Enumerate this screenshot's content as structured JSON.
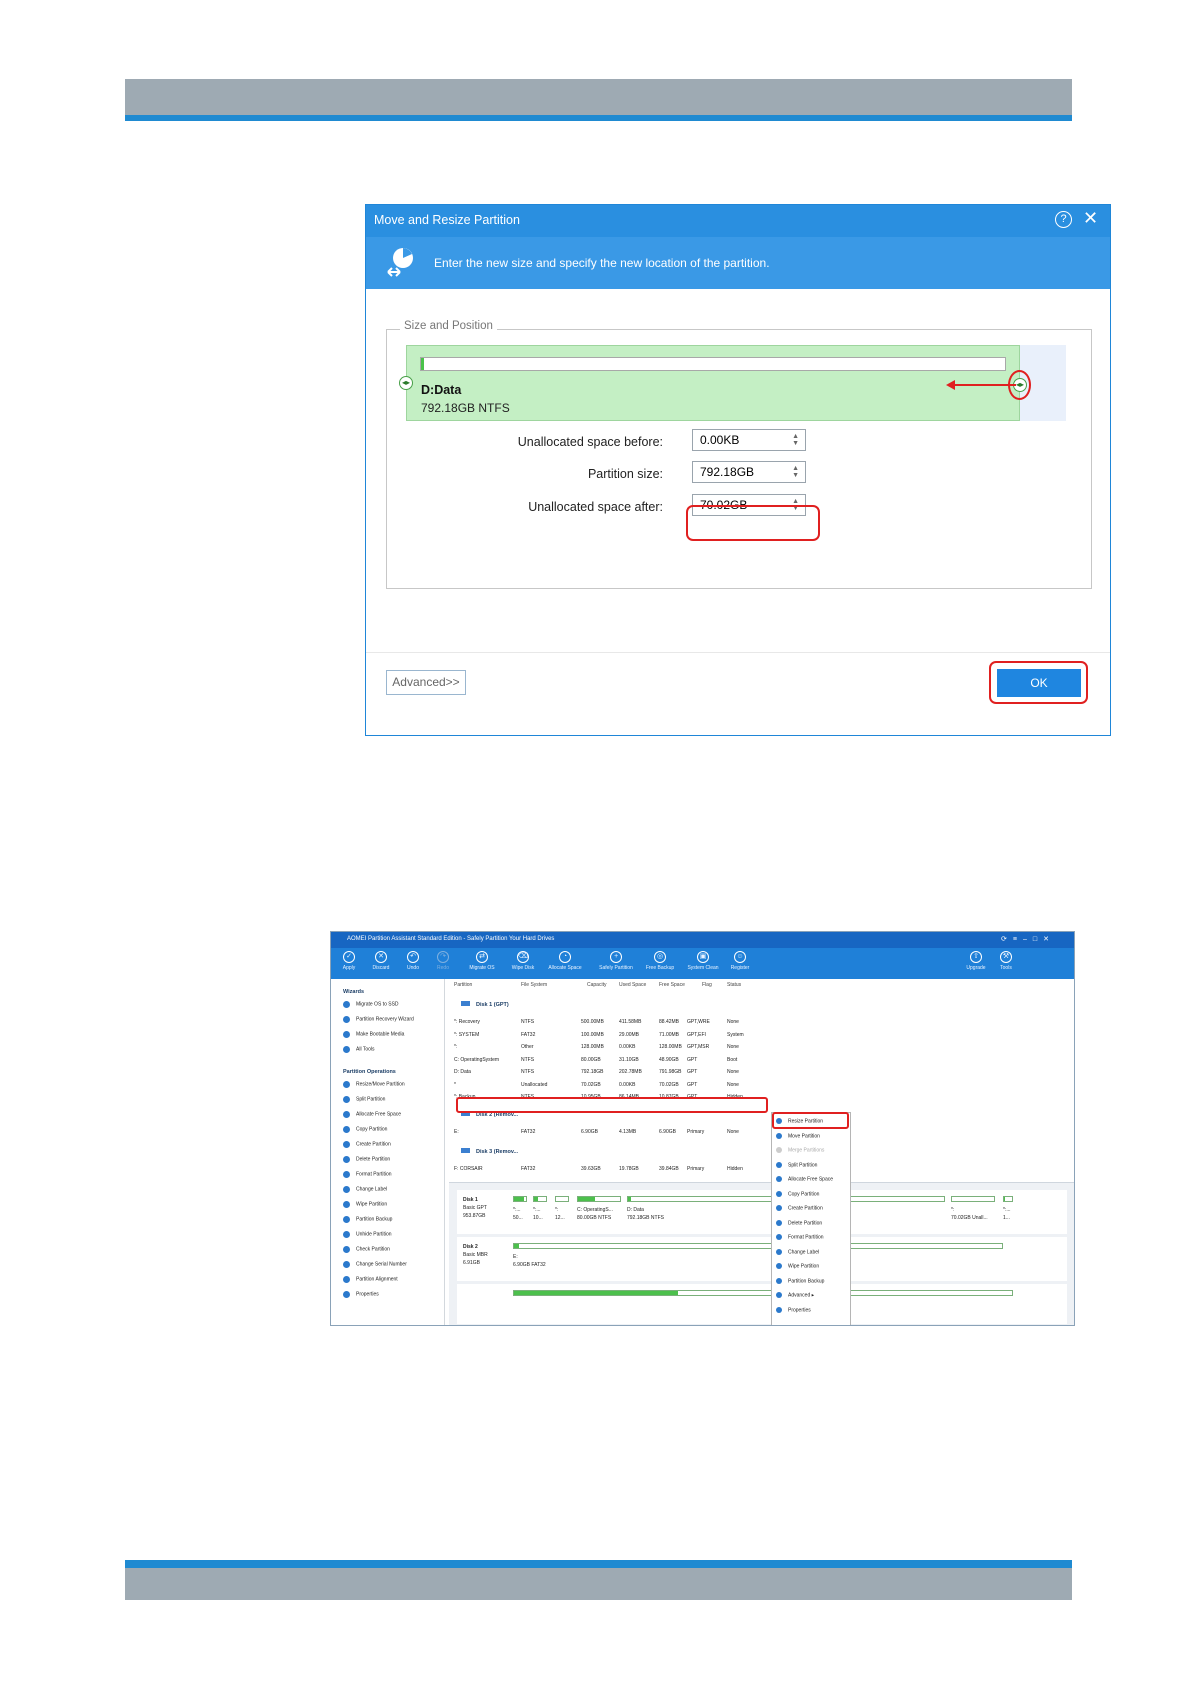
{
  "dialog": {
    "title": "Move and Resize Partition",
    "help_glyph": "?",
    "close_glyph": "✕",
    "banner_text": "Enter the new size and specify the new location of the partition.",
    "group_label": "Size and Position",
    "partition_name": "D:Data",
    "partition_size": "792.18GB NTFS",
    "unalloc_before_label": "Unallocated space before:",
    "unalloc_before_value": "0.00KB",
    "partition_size_label": "Partition size:",
    "partition_size_value": "792.18GB",
    "unalloc_after_label": "Unallocated space after:",
    "unalloc_after_value": "70.02GB",
    "advanced_button": "Advanced>>",
    "ok_button": "OK"
  },
  "aomei": {
    "title": "AOMEI Partition Assistant Standard Edition - Safely Partition Your Hard Drives",
    "toolbar": [
      "Apply",
      "Discard",
      "Undo",
      "Redo",
      "Migrate OS",
      "Wipe Disk",
      "Allocate Space",
      "Safely Partition",
      "Free Backup",
      "System Clean",
      "Register",
      "Upgrade",
      "Tools"
    ],
    "wizards_header": "Wizards",
    "wizards": [
      "Migrate OS to SSD",
      "Partition Recovery Wizard",
      "Make Bootable Media",
      "All Tools"
    ],
    "ops_header": "Partition Operations",
    "operations": [
      "Resize/Move Partition",
      "Split Partition",
      "Allocate Free Space",
      "Copy Partition",
      "Create Partition",
      "Delete Partition",
      "Format Partition",
      "Change Label",
      "Wipe Partition",
      "Partition Backup",
      "Unhide Partition",
      "Check Partition",
      "Change Serial Number",
      "Partition Alignment",
      "Properties"
    ],
    "columns": [
      "Partition",
      "File System",
      "Capacity",
      "Used Space",
      "Free Space",
      "Flag",
      "Status"
    ],
    "disk1_header": "Disk 1 (GPT)",
    "disk1_rows": [
      [
        "*: Recovery",
        "NTFS",
        "500.00MB",
        "411.58MB",
        "88.42MB",
        "GPT,WRE",
        "None"
      ],
      [
        "*: SYSTEM",
        "FAT32",
        "100.00MB",
        "29.00MB",
        "71.00MB",
        "GPT,EFI",
        "System"
      ],
      [
        "*:",
        "Other",
        "128.00MB",
        "0.00KB",
        "128.00MB",
        "GPT,MSR",
        "None"
      ],
      [
        "C: OperatingSystem",
        "NTFS",
        "80.00GB",
        "31.10GB",
        "48.90GB",
        "GPT",
        "Boot"
      ],
      [
        "D: Data",
        "NTFS",
        "792.18GB",
        "202.78MB",
        "791.98GB",
        "GPT",
        "None"
      ],
      [
        "*",
        "Unallocated",
        "70.02GB",
        "0.00KB",
        "70.02GB",
        "GPT",
        "None"
      ],
      [
        "*: Backup",
        "NTFS",
        "10.95GB",
        "86.14MB",
        "10.87GB",
        "GPT",
        "Hidden"
      ]
    ],
    "disk2_header": "Disk 2 (Remov...",
    "disk2_rows": [
      [
        "E:",
        "FAT32",
        "6.90GB",
        "4.13MB",
        "6.90GB",
        "Primary",
        "None"
      ]
    ],
    "disk3_header": "Disk 3 (Remov...",
    "disk3_rows": [
      [
        "F: CORSAIR",
        "FAT32",
        "39.63GB",
        "19.78GB",
        "39.84GB",
        "Primary",
        "Hidden"
      ]
    ],
    "context_menu": [
      "Resize Partition",
      "Move Partition",
      "Merge Partitions",
      "Split Partition",
      "Allocate Free Space",
      "Copy Partition",
      "Create Partition",
      "Delete Partition",
      "Format Partition",
      "Change Label",
      "Wipe Partition",
      "Partition Backup",
      "Advanced",
      "Properties"
    ],
    "map_disk1": {
      "name": "Disk 1",
      "type": "Basic GPT",
      "size": "953.87GB",
      "parts": [
        [
          "*:...",
          "50..."
        ],
        [
          "*:...",
          "10..."
        ],
        [
          "*:",
          "12..."
        ],
        [
          "C: OperatingS...",
          "80.00GB NTFS"
        ],
        [
          "D: Data",
          "792.18GB NTFS"
        ],
        [
          "*:",
          "70.02GB Unall..."
        ],
        [
          "*:...",
          "1..."
        ]
      ]
    },
    "map_disk2": {
      "name": "Disk 2",
      "type": "Basic MBR",
      "size": "6.91GB",
      "part_name": "E:",
      "part_detail": "6.90GB FAT32"
    }
  }
}
